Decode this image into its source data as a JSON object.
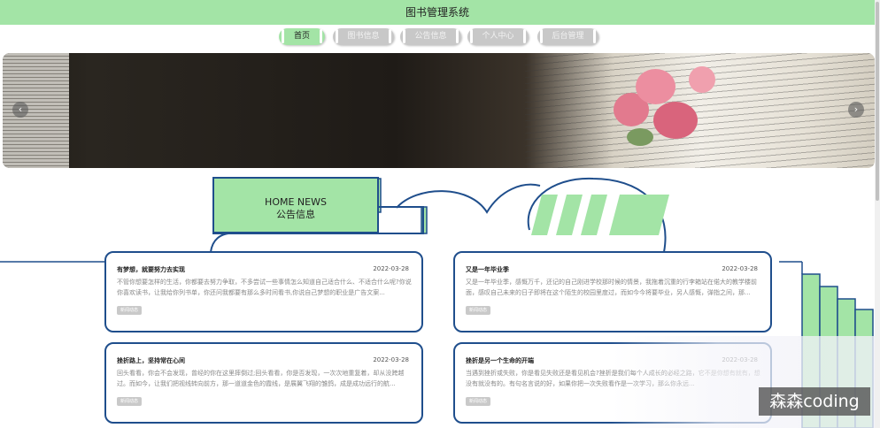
{
  "app": {
    "title": "图书管理系统"
  },
  "nav": [
    {
      "label": "首页",
      "active": true
    },
    {
      "label": "图书信息",
      "active": false
    },
    {
      "label": "公告信息",
      "active": false
    },
    {
      "label": "个人中心",
      "active": false
    },
    {
      "label": "后台管理",
      "active": false
    }
  ],
  "banner": {
    "prev_icon": "chevron-left-icon",
    "next_icon": "chevron-right-icon",
    "prev_glyph": "‹",
    "next_glyph": "›"
  },
  "news": {
    "title_en": "HOME NEWS",
    "title_cn": "公告信息",
    "cards": [
      {
        "title": "有梦想，就要努力去实现",
        "date": "2022-03-28",
        "desc": "不管你想要怎样的生活，你都要去努力争取，不多尝试一些事情怎么知道自己适合什么、不适合什么呢?你说你喜欢读书，让我给你列书单，你还问我都要有那么多时间看书,你说自己梦想的职业是广告文案...",
        "tag": "新闻动态"
      },
      {
        "title": "又是一年毕业季",
        "date": "2022-03-28",
        "desc": "又是一年毕业季，感慨万千，还记的自己刚进学校那时候的情景，我拖着沉重的行李箱站在偌大的教学楼前面，感叹自己未来的日子即将在这个陌生的校园里度过，而如今今将要毕业，另人感慨，弹指之间，那...",
        "tag": "新闻动态"
      },
      {
        "title": "挫折路上，坚持常在心间",
        "date": "2022-03-28",
        "desc": "回头看看，你会不会发现，曾经的你在这里摔倒过;回头看看，你是否发现，一次次地重复着，却从没跨越过。而如今，让我们把视线转向前方，那一道道金色的霞线，是展翼飞翔的雏鸽，成是成功远行的航...",
        "tag": "新闻动态"
      },
      {
        "title": "挫折是另一个生命的开端",
        "date": "2022-03-28",
        "desc": "当遇到挫折或失败，你是看见失败还是看见机会?挫折是我们每个人成长的必经之路，它不是你想有就有，想没有就没有的。有句名言说的好，如果你把一次失败看作是一次学习，那么你永远...",
        "tag": "新闻动态"
      }
    ]
  },
  "watermark": "森森coding"
}
